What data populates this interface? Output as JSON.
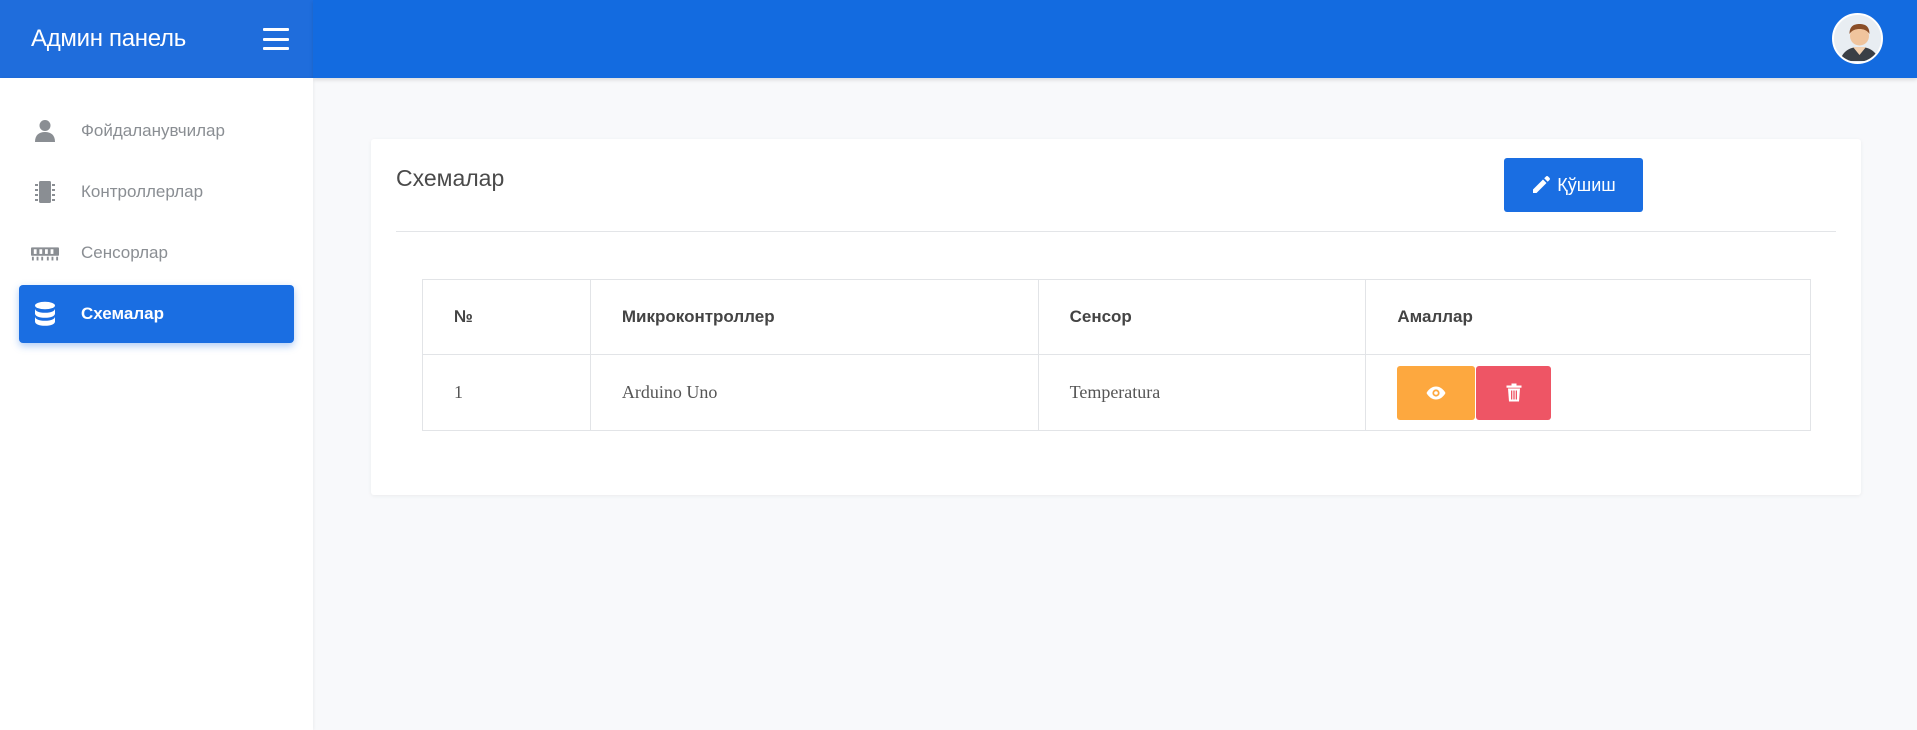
{
  "brand": {
    "title": "Админ панель"
  },
  "colors": {
    "primary": "#1a6ee2",
    "view": "#fda83f",
    "delete": "#ee5565"
  },
  "sidebar": {
    "items": [
      {
        "label": "Фойдаланувчилар",
        "icon": "user-icon",
        "active": false
      },
      {
        "label": "Контроллерлар",
        "icon": "chip-icon",
        "active": false
      },
      {
        "label": "Сенсорлар",
        "icon": "memory-icon",
        "active": false
      },
      {
        "label": "Схемалар",
        "icon": "database-icon",
        "active": true
      }
    ]
  },
  "main": {
    "card_title": "Схемалар",
    "add_label": "Қўшиш",
    "table": {
      "headers": [
        "№",
        "Микроконтроллер",
        "Сенсор",
        "Амаллар"
      ],
      "rows": [
        {
          "num": "1",
          "controller": "Arduino Uno",
          "sensor": "Temperatura"
        }
      ]
    }
  }
}
